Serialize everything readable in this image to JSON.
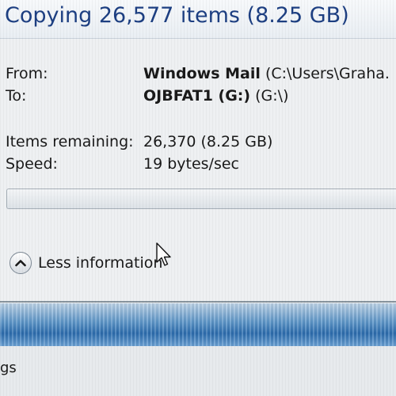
{
  "dialog": {
    "title": "Copying 26,577 items (8.25 GB)"
  },
  "details": {
    "from_label": "From:",
    "from_name": "Windows Mail",
    "from_path": "(C:\\Users\\Graha.",
    "to_label": "To:",
    "to_name": "OJBFAT1 (G:)",
    "to_path": "(G:\\)",
    "items_remaining_label": "Items remaining:",
    "items_remaining_value": "26,370 (8.25 GB)",
    "speed_label": "Speed:",
    "speed_value": "19 bytes/sec"
  },
  "progress": {
    "fraction": 0.0
  },
  "toggle": {
    "label": "Less information",
    "icon": "chevron-up-icon"
  },
  "footer": {
    "partial_text": "gs"
  },
  "colors": {
    "title": "#1d3f82",
    "footer_band": "#2d6eb0"
  }
}
